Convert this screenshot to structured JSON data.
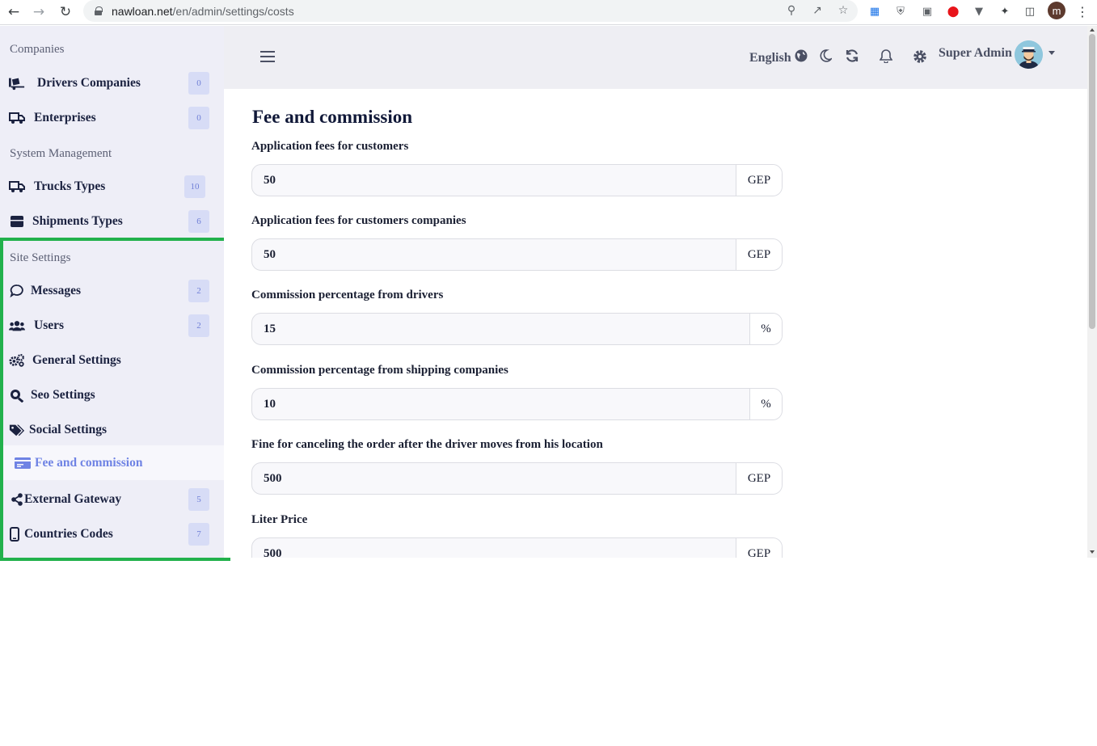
{
  "browser": {
    "url_host": "nawloan.net",
    "url_path": "/en/admin/settings/costs",
    "profile_initial": "m"
  },
  "sidebar": {
    "sections": {
      "companies": "Companies",
      "system": "System Management",
      "site": "Site Settings"
    },
    "items": [
      {
        "label": "Drivers Companies",
        "badge": "0",
        "icon": "truck-loading-icon"
      },
      {
        "label": "Enterprises",
        "badge": "0",
        "icon": "truck-icon"
      },
      {
        "label": "Trucks Types",
        "badge": "10",
        "icon": "truck-icon"
      },
      {
        "label": "Shipments Types",
        "badge": "6",
        "icon": "box-icon"
      },
      {
        "label": "Messages",
        "badge": "2",
        "icon": "chat-icon"
      },
      {
        "label": "Users",
        "badge": "2",
        "icon": "users-icon"
      },
      {
        "label": "General Settings",
        "icon": "gears-icon"
      },
      {
        "label": "Seo Settings",
        "icon": "seo-icon"
      },
      {
        "label": "Social Settings",
        "icon": "tags-icon"
      },
      {
        "label": "Fee and commission",
        "icon": "money-card-icon",
        "active": true
      },
      {
        "label": "External Gateway",
        "badge": "5",
        "icon": "share-icon"
      },
      {
        "label": "Countries Codes",
        "badge": "7",
        "icon": "mobile-icon"
      }
    ]
  },
  "topbar": {
    "language": "English",
    "user_name": "Super Admin"
  },
  "main": {
    "title": "Fee and commission",
    "fields": [
      {
        "label": "Application fees for customers",
        "value": "50",
        "unit": "GEP"
      },
      {
        "label": "Application fees for customers companies",
        "value": "50",
        "unit": "GEP"
      },
      {
        "label": "Commission percentage from drivers",
        "value": "15",
        "unit": "%"
      },
      {
        "label": "Commission percentage from shipping companies",
        "value": "10",
        "unit": "%"
      },
      {
        "label": "Fine for canceling the order after the driver moves from his location",
        "value": "500",
        "unit": "GEP"
      },
      {
        "label": "Liter Price",
        "value": "500",
        "unit": "GEP"
      }
    ]
  },
  "colors": {
    "sidebar_bg": "#eeeef7",
    "active_text": "#6f83e4",
    "badge_bg": "#d7dcf6",
    "highlight": "#22b14c"
  }
}
